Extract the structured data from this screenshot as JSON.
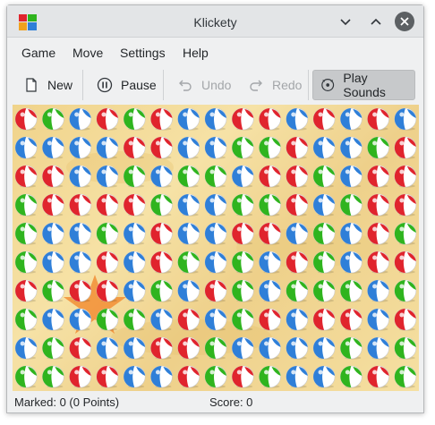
{
  "window": {
    "title": "Klickety"
  },
  "menu": [
    "Game",
    "Move",
    "Settings",
    "Help"
  ],
  "toolbar": {
    "new_label": "New",
    "pause_label": "Pause",
    "undo_label": "Undo",
    "redo_label": "Redo",
    "sounds_label": "Play Sounds"
  },
  "board": {
    "columns": 15,
    "rows": 10,
    "cells": [
      "RGBRGRBBRRBRBRB",
      "BBBBRRBBGGRBBGR",
      "RRBBGBGGBRRGBRR",
      "GRRRRGBBGGRBGRR",
      "GBBGBRBBRRBGBRG",
      "GBBRBRGBGBRGBRR",
      "RGRRBGBRGBGGGBG",
      "GBBGGBRBGRBRRBR",
      "BGRBBRRGBBBBGBG",
      "GGRRBBRGRGBBGRG"
    ],
    "colors": {
      "R": "#e0242d",
      "G": "#2fb41e",
      "B": "#2f7fd8"
    }
  },
  "status": {
    "marked": "Marked: 0 (0 Points)",
    "score": "Score: 0"
  }
}
